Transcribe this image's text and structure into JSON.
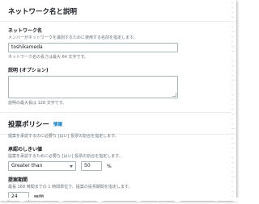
{
  "network": {
    "heading": "ネットワーク名と説明",
    "name_label": "ネットワーク名",
    "name_desc": "メンバーがネットワークを識別するために使用する名前を指定します。",
    "name_value": "toshikameda",
    "name_hint": "ネットワーク名の長さは最大 64 文字です。",
    "desc_label": "説明 (オプション)",
    "desc_value": "",
    "desc_hint": "説明の最大長は 128 文字です。"
  },
  "voting": {
    "heading": "投票ポリシー",
    "info_link": "情報",
    "description": "提案を承認するのに必要な [はい] 投票の割合を指定します。",
    "threshold_label": "承認のしきい値",
    "threshold_desc": "提案を承認するために必要な [はい] 投票の割合を指定します。",
    "comparator_value": "Greater than",
    "percent_value": "50",
    "percent_unit": "%",
    "duration_label": "提案期間",
    "duration_desc": "最長 168 時間までの 1 時間単位で、提案の投票期間を指定します。",
    "duration_value": "24",
    "duration_unit": "時間"
  }
}
